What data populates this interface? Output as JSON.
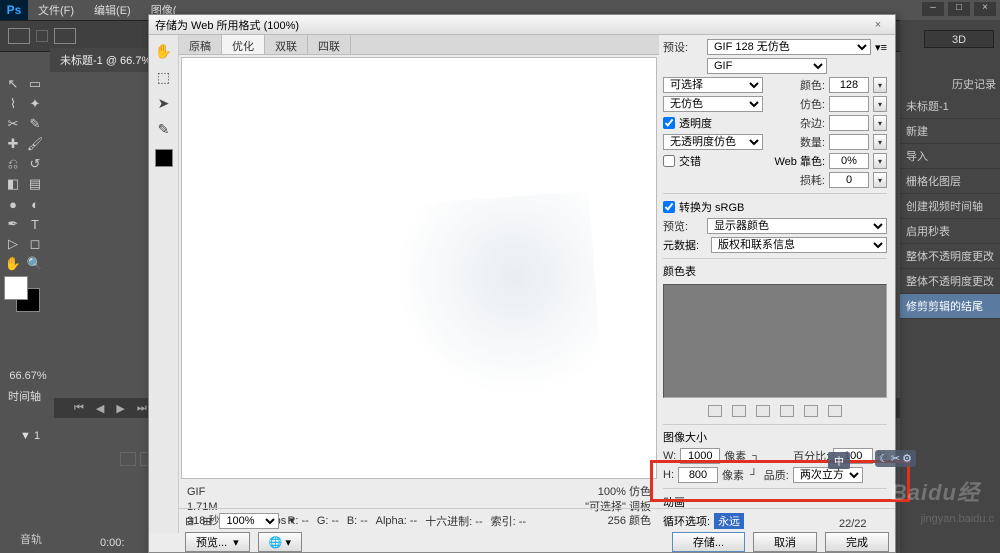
{
  "app": {
    "logo": "Ps",
    "title_x": "×"
  },
  "menubar": [
    "文件(F)",
    "编辑(E)",
    "图像("
  ],
  "doc_tab": "未标题-1 @ 66.7%",
  "zoom_indicator": "66.67%",
  "timeline_label": "时间轴",
  "timeline_item": "▼  1",
  "track_label": "音轨",
  "time_display": "0:00:",
  "window_buttons": [
    "–",
    "□",
    "×"
  ],
  "btn3d": "3D",
  "history": {
    "title": "历史记录",
    "items": [
      "未标题-1",
      "新建",
      "导入",
      "栅格化图层",
      "创建视频时间轴",
      "启用秒表",
      "整体不透明度更改",
      "整体不透明度更改",
      "修剪剪辑的结尾"
    ],
    "selected": 8
  },
  "dialog": {
    "title": "存储为 Web 所用格式 (100%)",
    "tool_icons": [
      "✋",
      "⬚",
      "➤",
      "✎"
    ],
    "tabs": [
      "原稿",
      "优化",
      "双联",
      "四联"
    ],
    "active_tab": 1,
    "preview_info": {
      "fmt": "GIF",
      "size": "1.71M",
      "speed": "318 秒 @ 56.6 Kbps  ▾",
      "pct": "100% 仿色",
      "sel": "\"可选择\"  调板",
      "colors": "256 颜色"
    },
    "preset_label": "预设:",
    "preset_value": "GIF 128 无仿色",
    "format_value": "GIF",
    "reduction_value": "可选择",
    "colors_label": "颜色:",
    "colors_value": "128",
    "dither_value": "无仿色",
    "dither_amt_label": "仿色:",
    "transparency_label": "透明度",
    "matte_label": "杂边:",
    "notrans_dither_value": "无透明度仿色",
    "amount_label": "数量:",
    "interlace_label": "交错",
    "websnap_label": "Web 靠色:",
    "websnap_value": "0%",
    "lossy_label": "损耗:",
    "lossy_value": "0",
    "srgb_label": "转换为 sRGB",
    "preview_mode_label": "预览:",
    "preview_mode_value": "显示器颜色",
    "metadata_label": "元数据:",
    "metadata_value": "版权和联系信息",
    "colortable_label": "颜色表",
    "imagesize_label": "图像大小",
    "width_label": "W:",
    "width_value": "1000",
    "px": "像素",
    "height_label": "H:",
    "height_value": "800",
    "percent_label": "百分比:",
    "percent_value": "100",
    "pct_sign": "%",
    "quality_label": "品质:",
    "quality_value": "两次立方",
    "anim_label": "动画",
    "loop_label": "循环选项:",
    "loop_value": "永远",
    "frame_display": "22/22",
    "zoom_row": {
      "minus": "⊟",
      "plus": "⊞",
      "zoom": "100%",
      "r": "R: --",
      "g": "G: --",
      "b": "B: --",
      "alpha": "Alpha: --",
      "hex": "十六进制: --",
      "index": "索引: --"
    },
    "buttons": {
      "preview": "预览...",
      "save": "存储...",
      "cancel": "取消",
      "done": "完成"
    }
  },
  "ime": "中",
  "watermark": "Baidu经",
  "watermark2": "jingyan.baidu.c"
}
